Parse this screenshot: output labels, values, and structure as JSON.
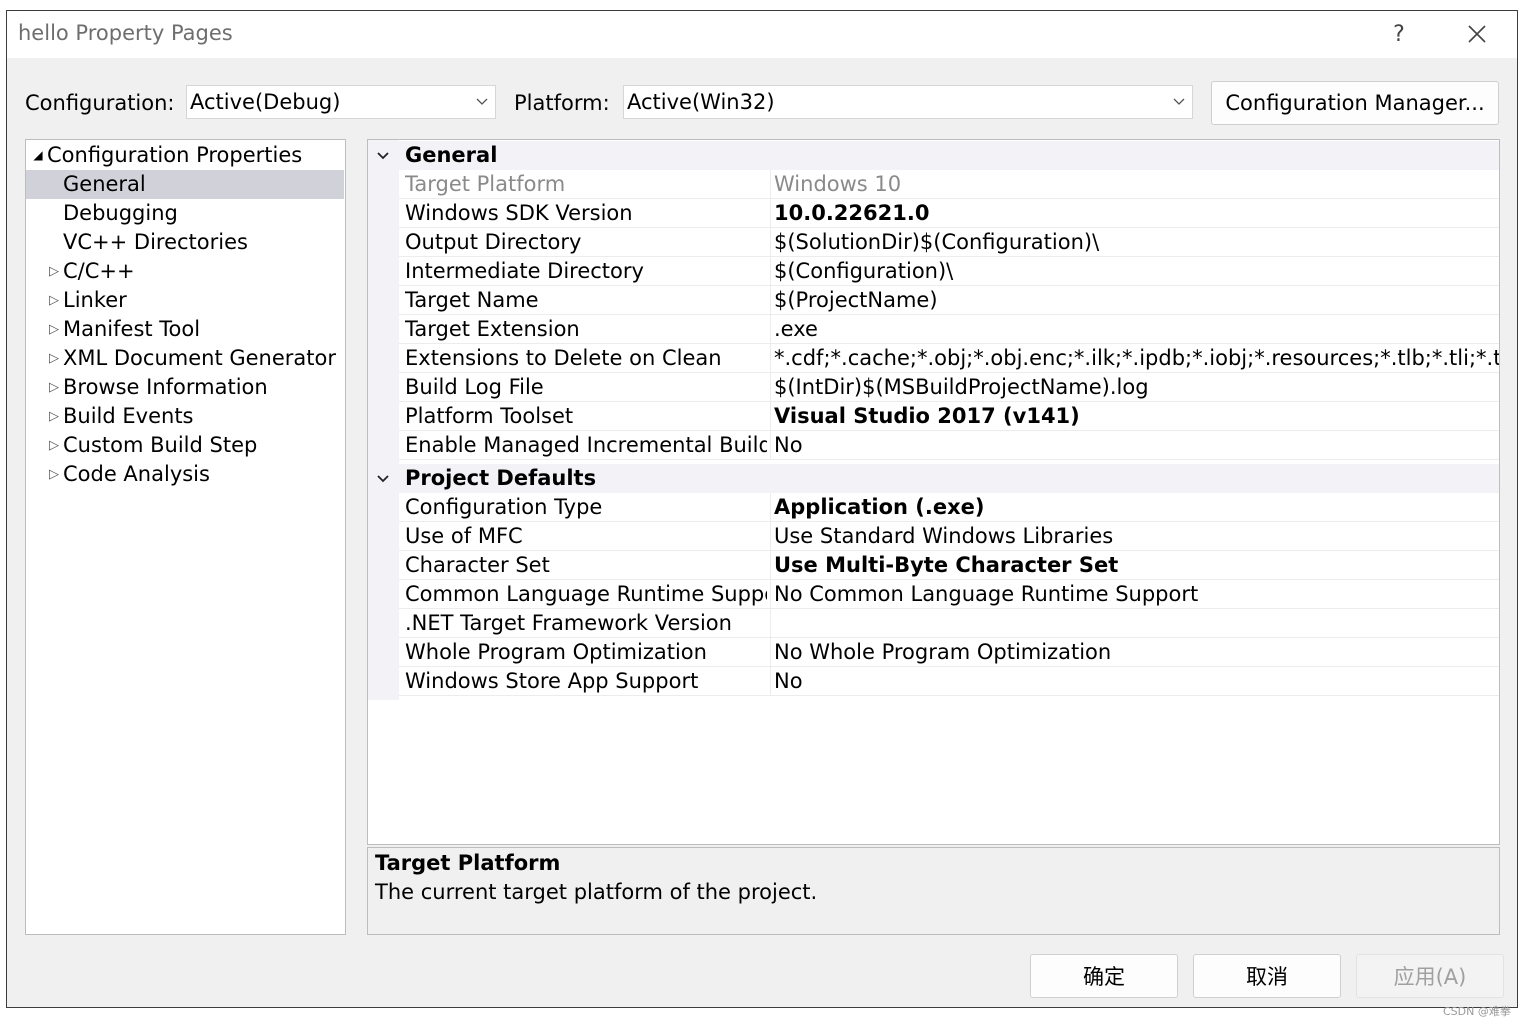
{
  "window": {
    "title": "hello Property Pages",
    "help_glyph": "?"
  },
  "config_bar": {
    "configuration_label": "Configuration:",
    "configuration_value": "Active(Debug)",
    "platform_label": "Platform:",
    "platform_value": "Active(Win32)",
    "manager_button": "Configuration Manager..."
  },
  "tree": {
    "items": [
      {
        "label": "Configuration Properties",
        "arrow": "◢"
      },
      {
        "label": "General",
        "arrow": ""
      },
      {
        "label": "Debugging",
        "arrow": ""
      },
      {
        "label": "VC++ Directories",
        "arrow": ""
      },
      {
        "label": "C/C++",
        "arrow": "▷"
      },
      {
        "label": "Linker",
        "arrow": "▷"
      },
      {
        "label": "Manifest Tool",
        "arrow": "▷"
      },
      {
        "label": "XML Document Generator",
        "arrow": "▷"
      },
      {
        "label": "Browse Information",
        "arrow": "▷"
      },
      {
        "label": "Build Events",
        "arrow": "▷"
      },
      {
        "label": "Custom Build Step",
        "arrow": "▷"
      },
      {
        "label": "Code Analysis",
        "arrow": "▷"
      }
    ]
  },
  "grid": {
    "categories": [
      {
        "label": "General",
        "properties": [
          {
            "name": "Target Platform",
            "value": "Windows 10",
            "bold": false,
            "readonly": true
          },
          {
            "name": "Windows SDK Version",
            "value": "10.0.22621.0",
            "bold": true,
            "readonly": false
          },
          {
            "name": "Output Directory",
            "value": "$(SolutionDir)$(Configuration)\\",
            "bold": false,
            "readonly": false
          },
          {
            "name": "Intermediate Directory",
            "value": "$(Configuration)\\",
            "bold": false,
            "readonly": false
          },
          {
            "name": "Target Name",
            "value": "$(ProjectName)",
            "bold": false,
            "readonly": false
          },
          {
            "name": "Target Extension",
            "value": ".exe",
            "bold": false,
            "readonly": false
          },
          {
            "name": "Extensions to Delete on Clean",
            "value": "*.cdf;*.cache;*.obj;*.obj.enc;*.ilk;*.ipdb;*.iobj;*.resources;*.tlb;*.tli;*.tlh;*.tmp",
            "bold": false,
            "readonly": false
          },
          {
            "name": "Build Log File",
            "value": "$(IntDir)$(MSBuildProjectName).log",
            "bold": false,
            "readonly": false
          },
          {
            "name": "Platform Toolset",
            "value": "Visual Studio 2017 (v141)",
            "bold": true,
            "readonly": false
          },
          {
            "name": "Enable Managed Incremental Build",
            "value": "No",
            "bold": false,
            "readonly": false
          }
        ]
      },
      {
        "label": "Project Defaults",
        "properties": [
          {
            "name": "Configuration Type",
            "value": "Application (.exe)",
            "bold": true,
            "readonly": false
          },
          {
            "name": "Use of MFC",
            "value": "Use Standard Windows Libraries",
            "bold": false,
            "readonly": false
          },
          {
            "name": "Character Set",
            "value": "Use Multi-Byte Character Set",
            "bold": true,
            "readonly": false
          },
          {
            "name": "Common Language Runtime Support",
            "value": "No Common Language Runtime Support",
            "bold": false,
            "readonly": false
          },
          {
            "name": ".NET Target Framework Version",
            "value": "",
            "bold": false,
            "readonly": false
          },
          {
            "name": "Whole Program Optimization",
            "value": "No Whole Program Optimization",
            "bold": false,
            "readonly": false
          },
          {
            "name": "Windows Store App Support",
            "value": "No",
            "bold": false,
            "readonly": false
          }
        ]
      }
    ]
  },
  "description": {
    "title": "Target Platform",
    "text": "The current target platform of the project."
  },
  "buttons": {
    "ok": "确定",
    "cancel": "取消",
    "apply": "应用(A)"
  },
  "watermark": "CSDN @难拳"
}
